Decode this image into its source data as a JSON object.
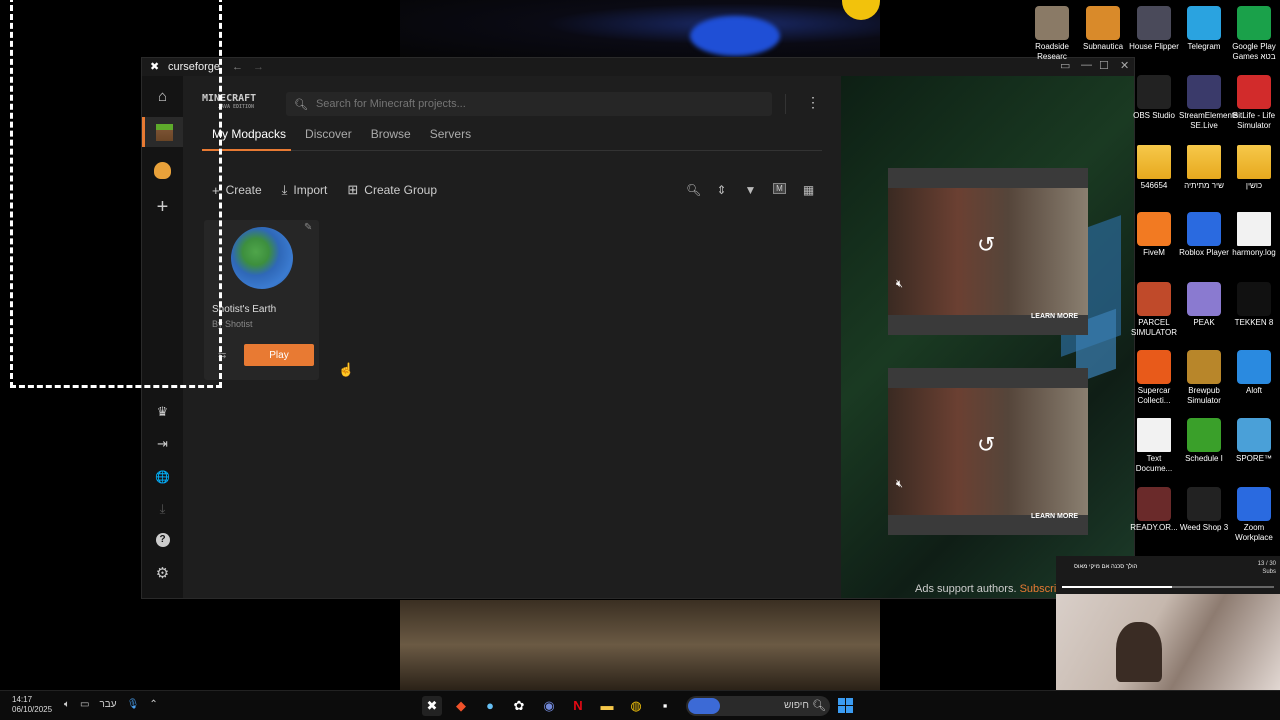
{
  "window": {
    "app_name": "curseforge",
    "back_arrow": "←",
    "forward_arrow": "→",
    "controls": [
      "▭",
      "—",
      "☐",
      "✕"
    ]
  },
  "sidebar": {
    "items": [
      {
        "name": "home",
        "icon": "⌂"
      },
      {
        "name": "minecraft",
        "icon": "grass-block-icon"
      },
      {
        "name": "game2",
        "icon": "duck-icon"
      },
      {
        "name": "add-game",
        "icon": "+"
      },
      {
        "name": "premium",
        "icon": "♛"
      },
      {
        "name": "login",
        "icon": "⇥"
      },
      {
        "name": "language",
        "icon": "🌐"
      },
      {
        "name": "download",
        "icon": "⤓"
      },
      {
        "name": "help",
        "icon": "?"
      },
      {
        "name": "settings",
        "icon": "⚙"
      }
    ]
  },
  "header": {
    "game_logo": "MINECRAFT",
    "game_logo_sub": "JAVA EDITION",
    "search_placeholder": "Search for Minecraft projects...",
    "menu_icon": "⋮"
  },
  "tabs": [
    {
      "label": "My Modpacks",
      "active": true
    },
    {
      "label": "Discover",
      "active": false
    },
    {
      "label": "Browse",
      "active": false
    },
    {
      "label": "Servers",
      "active": false
    }
  ],
  "toolbar": {
    "create_label": "Create",
    "import_label": "Import",
    "create_group_label": "Create Group",
    "right_icons": [
      "search-icon",
      "sort-icon",
      "filter-icon",
      "m-icon",
      "grid-icon"
    ],
    "m_badge": "M"
  },
  "modpack": {
    "name": "Shotist's Earth",
    "author": "By Shotist",
    "play_label": "Play"
  },
  "ads": {
    "learn_more": "LEARN MORE",
    "note": "Ads support authors.",
    "subscribe_link": "Subscrib"
  },
  "desktop_icons": [
    {
      "label": "Roadside Researc",
      "color": "#8a7a66"
    },
    {
      "label": "Subnautica",
      "color": "#d98a2a"
    },
    {
      "label": "House Flipper",
      "color": "#4a4a5a"
    },
    {
      "label": "Telegram",
      "color": "#2aa3e0"
    },
    {
      "label": "Google Play Games בטא",
      "color": "#1aa14a"
    },
    {
      "label": "OBS Studio",
      "color": "#222"
    },
    {
      "label": "StreamElements SE.Live",
      "color": "#3a3a6a"
    },
    {
      "label": "BitLife - Life Simulator",
      "color": "#d22b2b"
    },
    {
      "label": "546654",
      "color": "folder"
    },
    {
      "label": "שיר מתיתיה",
      "color": "folder"
    },
    {
      "label": "כושין",
      "color": "folder"
    },
    {
      "label": "FiveM",
      "color": "#f27a22"
    },
    {
      "label": "Roblox Player",
      "color": "#2a6ae0"
    },
    {
      "label": "harmony.log",
      "color": "doc"
    },
    {
      "label": "PARCEL SIMULATOR",
      "color": "#c04a2a"
    },
    {
      "label": "PEAK",
      "color": "#8a7ad0"
    },
    {
      "label": "TEKKEN 8",
      "color": "#111"
    },
    {
      "label": "Supercar Collecti...",
      "color": "#e85a1a"
    },
    {
      "label": "Brewpub Simulator",
      "color": "#b8862a"
    },
    {
      "label": "Aloft",
      "color": "#2a8ae0"
    },
    {
      "label": "Text Docume...",
      "color": "doc"
    },
    {
      "label": "Schedule I",
      "color": "#3aa02a"
    },
    {
      "label": "SPORE™",
      "color": "#4aa0d8"
    },
    {
      "label": "READY.OR...",
      "color": "#6a2a2a"
    },
    {
      "label": "Weed Shop 3",
      "color": "#222"
    },
    {
      "label": "Zoom Workplace",
      "color": "#2a6ae0"
    }
  ],
  "overlay": {
    "title": "הולך סכנה אם מיקי מאוס",
    "count": "13 / 30",
    "subs": "Subs"
  },
  "taskbar": {
    "time": "14:17",
    "date": "06/10/2025",
    "lang": "עבר",
    "search_label": "חיפוש"
  }
}
